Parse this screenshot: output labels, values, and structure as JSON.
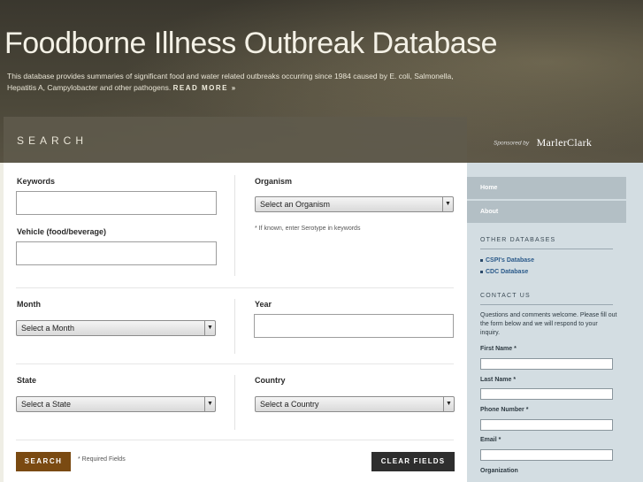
{
  "header": {
    "title": "Foodborne Illness Outbreak Database",
    "description": "This database provides summaries of significant food and water related outbreaks occurring since 1984 caused by E. coli, Salmonella, Hepatitis A, Campylobacter and other pathogens.",
    "read_more": "READ MORE »",
    "search_heading": "SEARCH",
    "sponsor_label": "Sponsored by",
    "sponsor_name": "MarlerClark"
  },
  "form": {
    "keywords_label": "Keywords",
    "vehicle_label": "Vehicle (food/beverage)",
    "organism_label": "Organism",
    "organism_select": "Select an Organism",
    "organism_note": "* If known, enter Serotype in keywords",
    "month_label": "Month",
    "month_select": "Select a Month",
    "year_label": "Year",
    "state_label": "State",
    "state_select": "Select a State",
    "country_label": "Country",
    "country_select": "Select a Country",
    "search_button": "SEARCH",
    "required_note": "* Required Fields",
    "clear_button": "CLEAR FIELDS"
  },
  "sidebar": {
    "nav": [
      {
        "label": "Home"
      },
      {
        "label": "About"
      }
    ],
    "other_databases_heading": "OTHER DATABASES",
    "databases": [
      {
        "label": "CSPI's Database"
      },
      {
        "label": "CDC Database"
      }
    ],
    "contact_heading": "CONTACT US",
    "contact_text": "Questions and comments welcome. Please fill out the form below and we will respond to your inquiry.",
    "fields": [
      {
        "label": "First Name *"
      },
      {
        "label": "Last Name *"
      },
      {
        "label": "Phone Number *"
      },
      {
        "label": "Email *"
      },
      {
        "label": "Organization"
      }
    ]
  },
  "colors": {
    "search_button": "#7a4a12",
    "clear_button": "#2e2e2e",
    "sidebar_bg": "#d3dde2",
    "link": "#2b5a8a"
  }
}
